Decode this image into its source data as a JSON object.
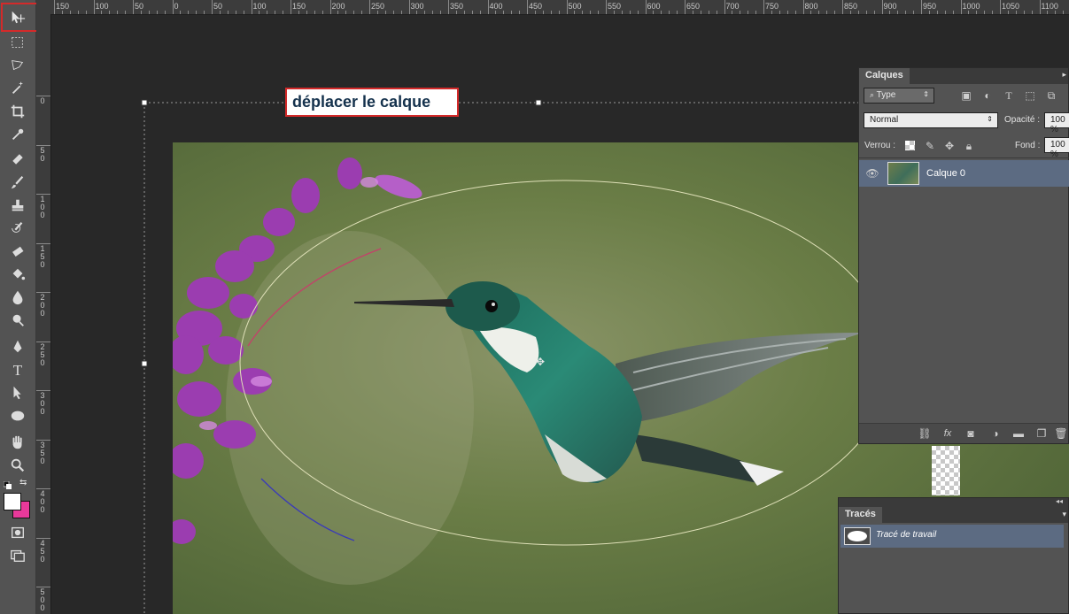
{
  "rulers": {
    "horizontal": [
      "150",
      "100",
      "50",
      "0",
      "50",
      "100",
      "150",
      "200",
      "250",
      "300",
      "350",
      "400",
      "450",
      "500",
      "550",
      "600",
      "650",
      "700",
      "750",
      "800",
      "850",
      "900",
      "950",
      "1000",
      "1050",
      "1100"
    ],
    "vertical": [
      "0",
      "5\n0",
      "1\n0\n0",
      "1\n5\n0",
      "2\n0\n0",
      "2\n5\n0",
      "3\n0\n0",
      "3\n5\n0",
      "4\n0\n0",
      "4\n5\n0",
      "5\n0\n0",
      "5\n5\n0"
    ]
  },
  "tooltip": {
    "text": "déplacer le calque"
  },
  "layers_panel": {
    "tab": "Calques",
    "filter_kind": "Type",
    "blend_mode": "Normal",
    "opacity_label": "Opacité :",
    "opacity_value": "100 %",
    "lock_label": "Verrou :",
    "fill_label": "Fond :",
    "fill_value": "100 %",
    "layers": [
      {
        "name": "Calque 0",
        "visible": true
      }
    ]
  },
  "paths_panel": {
    "tab": "Tracés",
    "paths": [
      {
        "name": "Tracé de travail"
      }
    ]
  },
  "colors": {
    "foreground": "#ffffff",
    "background": "#e8399a",
    "accent": "#d42a2a"
  }
}
